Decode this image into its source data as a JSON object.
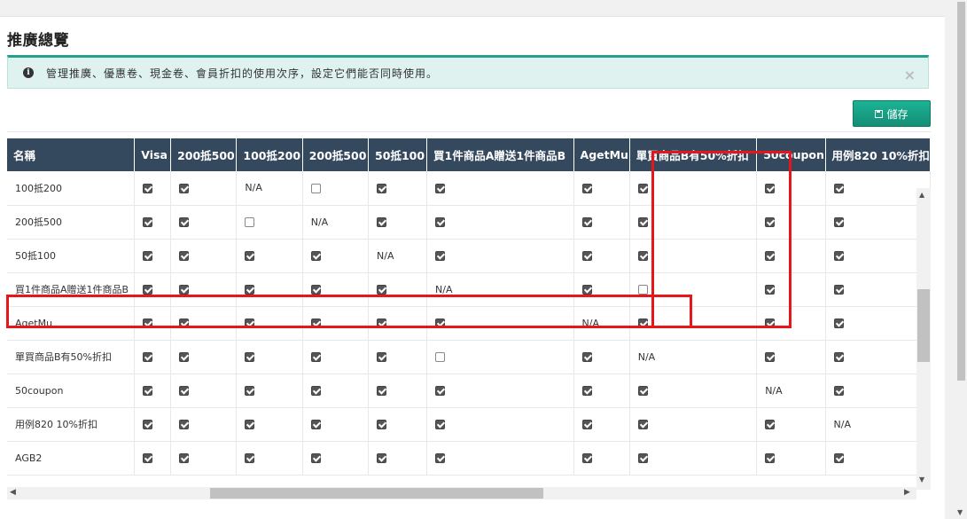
{
  "page": {
    "title": "推廣總覽"
  },
  "alert": {
    "icon": "info-icon",
    "text": "管理推廣、優惠卷、現金卷、會員折扣的使用次序，設定它們能否同時使用。",
    "close": "×"
  },
  "toolbar": {
    "save_icon": "floppy-disk-icon",
    "save_label": "儲存"
  },
  "table": {
    "columns": [
      "名稱",
      "Visa",
      "200抵500",
      "100抵200",
      "200抵500",
      "50抵100",
      "買1件商品A贈送1件商品B",
      "AgetMu",
      "單買商品B有50%折扣",
      "50coupon",
      "用例820 10%折扣"
    ],
    "rows": [
      {
        "name": "100抵200",
        "cells": [
          "on",
          "on",
          "N/A",
          "off",
          "on",
          "on",
          "on",
          "on",
          "on",
          "on"
        ]
      },
      {
        "name": "200抵500",
        "cells": [
          "on",
          "on",
          "off",
          "N/A",
          "on",
          "on",
          "on",
          "on",
          "on",
          "on"
        ]
      },
      {
        "name": "50抵100",
        "cells": [
          "on",
          "on",
          "on",
          "on",
          "N/A",
          "on",
          "on",
          "on",
          "on",
          "on"
        ]
      },
      {
        "name": "買1件商品A贈送1件商品B",
        "cells": [
          "on",
          "on",
          "on",
          "on",
          "on",
          "N/A",
          "on",
          "off",
          "on",
          "on"
        ]
      },
      {
        "name": "AgetMu",
        "cells": [
          "on",
          "on",
          "on",
          "on",
          "on",
          "on",
          "N/A",
          "on",
          "on",
          "on"
        ]
      },
      {
        "name": "單買商品B有50%折扣",
        "cells": [
          "on",
          "on",
          "on",
          "on",
          "on",
          "off",
          "on",
          "N/A",
          "on",
          "on"
        ]
      },
      {
        "name": "50coupon",
        "cells": [
          "on",
          "on",
          "on",
          "on",
          "on",
          "on",
          "on",
          "on",
          "N/A",
          "on"
        ]
      },
      {
        "name": "用例820 10%折扣",
        "cells": [
          "on",
          "on",
          "on",
          "on",
          "on",
          "on",
          "on",
          "on",
          "on",
          "N/A"
        ]
      },
      {
        "name": "AGB2",
        "cells": [
          "on",
          "on",
          "on",
          "on",
          "on",
          "on",
          "on",
          "on",
          "on",
          "on"
        ]
      }
    ]
  },
  "colors": {
    "header_bg": "#34495e",
    "accent": "#16a085",
    "highlight": "#e8151b"
  }
}
